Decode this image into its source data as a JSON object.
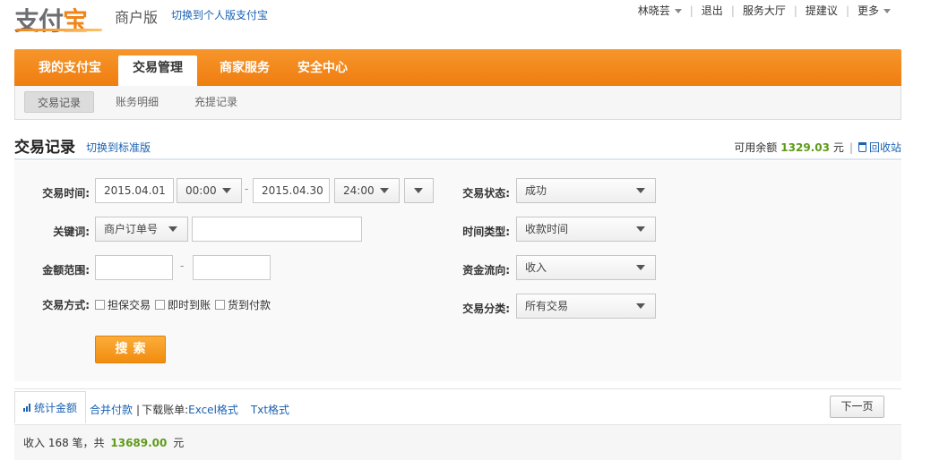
{
  "header": {
    "logo_main": "支付",
    "logo_accent": "宝",
    "edition": "商户版",
    "switch_personal": "切换到个人版支付宝",
    "user": "林晓芸",
    "logout": "退出",
    "service_hall": "服务大厅",
    "suggest": "提建议",
    "more": "更多"
  },
  "mainnav": {
    "items": [
      "我的支付宝",
      "交易管理",
      "商家服务",
      "安全中心"
    ],
    "active": "交易管理"
  },
  "subnav": {
    "items": [
      "交易记录",
      "账务明细",
      "充提记录"
    ],
    "active": "交易记录"
  },
  "page": {
    "title": "交易记录",
    "switch_standard": "切换到标准版",
    "balance_label": "可用余额",
    "balance_amount": "1329.03",
    "balance_unit": "元",
    "recycle": "回收站"
  },
  "form": {
    "trade_time_label": "交易时间:",
    "start_date": "2015.04.01",
    "start_time": "00:00",
    "dash": "-",
    "end_date": "2015.04.30",
    "end_time": "24:00",
    "keyword_label": "关键词:",
    "keyword_type": "商户订单号",
    "keyword_value": "",
    "amount_label": "金额范围:",
    "amount_min": "",
    "amount_max": "",
    "method_label": "交易方式:",
    "methods": [
      "担保交易",
      "即时到账",
      "货到付款"
    ],
    "status_label": "交易状态:",
    "status_value": "成功",
    "time_type_label": "时间类型:",
    "time_type_value": "收款时间",
    "flow_label": "资金流向:",
    "flow_value": "收入",
    "category_label": "交易分类:",
    "category_value": "所有交易",
    "search_button": "搜索"
  },
  "results": {
    "stat_tab": "统计金额",
    "merge_pay": "合并付款",
    "download_label": "下载账单:",
    "excel": "Excel格式",
    "txt": "Txt格式",
    "next_page": "下一页",
    "summary_prefix": "收入 168 笔，共",
    "summary_amount": "13689.00",
    "summary_unit": "元"
  },
  "colors": {
    "brand_orange": "#f08519",
    "link_blue": "#1a62b3",
    "amount_green": "#5e9a1a"
  }
}
